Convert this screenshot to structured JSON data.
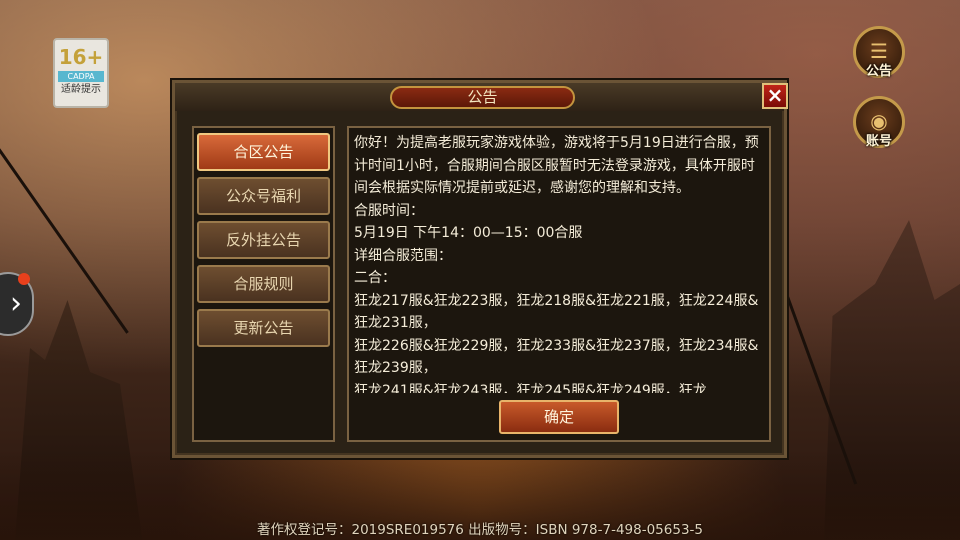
{
  "age_badge": {
    "number": "16+",
    "org": "CADPA",
    "tip": "适龄提示"
  },
  "side_nav": {
    "arrow": "›"
  },
  "right_buttons": [
    {
      "label": "公告",
      "icon": "scroll-icon"
    },
    {
      "label": "账号",
      "icon": "account-icon"
    }
  ],
  "dialog": {
    "title": "公告",
    "close": "×",
    "tabs": [
      {
        "label": "合区公告",
        "active": true
      },
      {
        "label": "公众号福利",
        "active": false
      },
      {
        "label": "反外挂公告",
        "active": false
      },
      {
        "label": "合服规则",
        "active": false
      },
      {
        "label": "更新公告",
        "active": false
      }
    ],
    "content_lines": [
      "你好！为提高老服玩家游戏体验，游戏将于5月19日进行合服，预计时间1小时，合服期间合服区服暂时无法登录游戏，具体开服时间会根据实际情况提前或延迟，感谢您的理解和支持。",
      "合服时间：",
      "5月19日 下午14：00—15：00合服",
      "详细合服范围：",
      "二合：",
      "狂龙217服&狂龙223服，狂龙218服&狂龙221服，狂龙224服&狂龙231服，",
      "狂龙226服&狂龙229服，狂龙233服&狂龙237服，狂龙234服&狂龙239服，",
      "狂龙241服&狂龙243服，狂龙245服&狂龙249服，狂龙"
    ],
    "confirm": "确定"
  },
  "footer": "著作权登记号：2019SRE019576 出版物号：ISBN 978-7-498-05653-5"
}
